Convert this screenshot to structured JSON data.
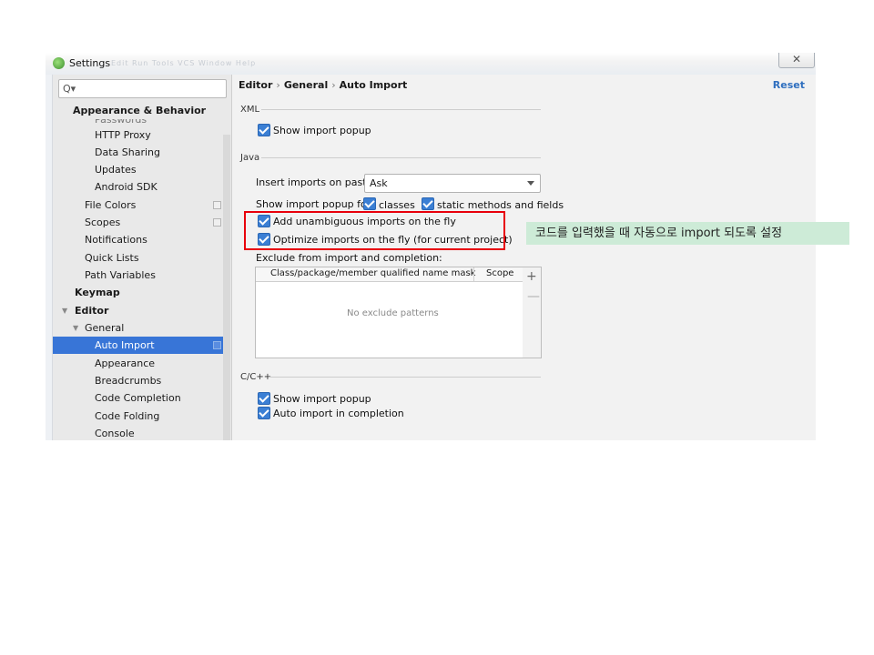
{
  "window": {
    "title": "Settings",
    "ghost_menu": "Edit  Run  Tools  VCS  Window  Help",
    "close_glyph": "✕"
  },
  "search": {
    "placeholder": "",
    "glyph": "Q▾"
  },
  "sidebar": {
    "items": [
      {
        "label": "Appearance & Behavior"
      },
      {
        "label": "Passwords"
      },
      {
        "label": "HTTP Proxy"
      },
      {
        "label": "Data Sharing"
      },
      {
        "label": "Updates"
      },
      {
        "label": "Android SDK"
      },
      {
        "label": "File Colors"
      },
      {
        "label": "Scopes"
      },
      {
        "label": "Notifications"
      },
      {
        "label": "Quick Lists"
      },
      {
        "label": "Path Variables"
      },
      {
        "label": "Keymap"
      },
      {
        "label": "Editor"
      },
      {
        "label": "General"
      },
      {
        "label": "Auto Import",
        "selected": true
      },
      {
        "label": "Appearance"
      },
      {
        "label": "Breadcrumbs"
      },
      {
        "label": "Code Completion"
      },
      {
        "label": "Code Folding"
      },
      {
        "label": "Console"
      }
    ]
  },
  "breadcrumb": {
    "parts": [
      "Editor",
      "General",
      "Auto Import"
    ],
    "separator": "›"
  },
  "reset_label": "Reset",
  "xml": {
    "section_label": "XML",
    "show_import_popup": {
      "label": "Show import popup",
      "checked": true
    }
  },
  "java": {
    "section_label": "Java",
    "insert_on_paste_label": "Insert imports on paste:",
    "insert_on_paste_value": "Ask",
    "popup_for_label": "Show import popup for:",
    "classes_label": "classes",
    "static_label": "static methods and fields",
    "add_unambiguous_label": "Add unambiguous imports on the fly",
    "optimize_label": "Optimize imports on the fly (for current project)",
    "exclude_label": "Exclude from import and completion:",
    "table_col1": "Class/package/member qualified name mask",
    "table_col2": "Scope",
    "table_empty": "No exclude patterns",
    "add_glyph": "+",
    "remove_glyph": "—"
  },
  "cpp": {
    "section_label": "C/C++",
    "show_import_popup_label": "Show import popup",
    "auto_import_label": "Auto import in completion"
  },
  "annotation": {
    "text": "코드를 입력했을 때 자동으로 import 되도록 설정",
    "bg_color": "#cdebd7",
    "box_color": "#e8000b"
  }
}
